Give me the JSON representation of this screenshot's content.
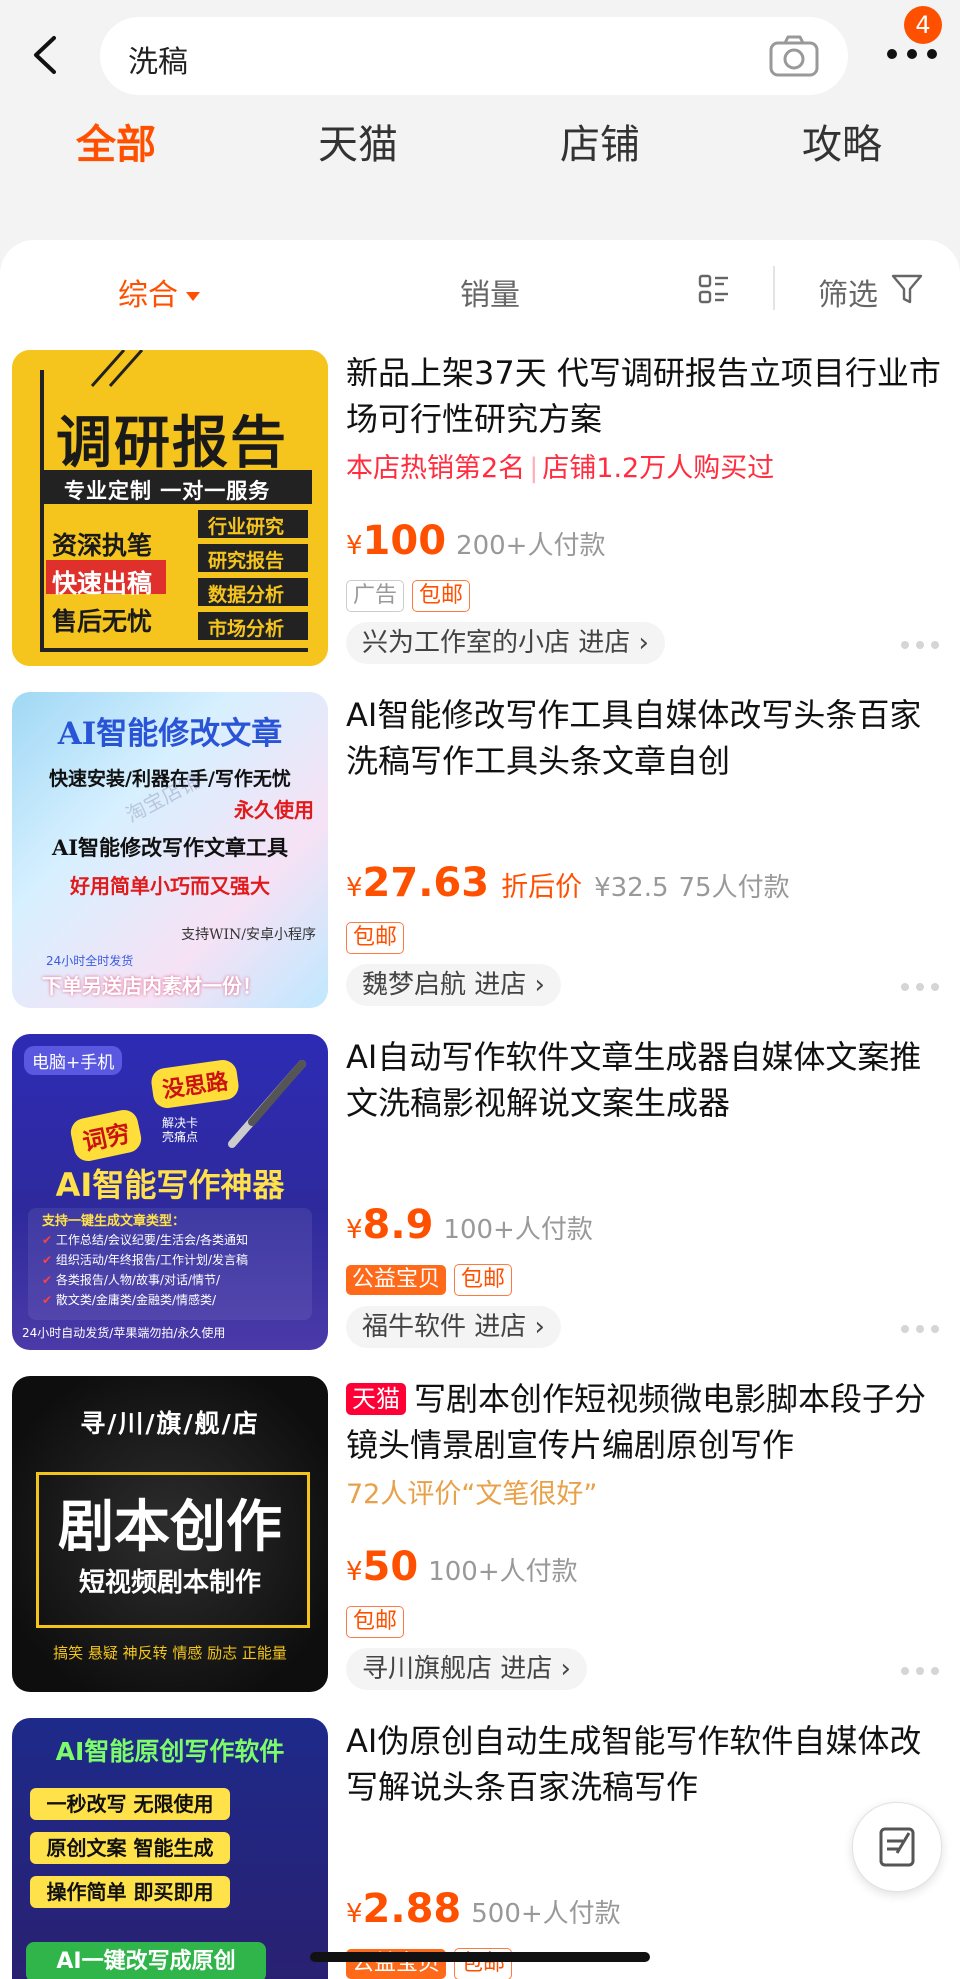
{
  "search": {
    "query": "洗稿",
    "badge_count": "4"
  },
  "tabs": [
    {
      "label": "全部",
      "active": true
    },
    {
      "label": "天猫",
      "active": false
    },
    {
      "label": "店铺",
      "active": false
    },
    {
      "label": "攻略",
      "active": false
    }
  ],
  "sort": {
    "comprehensive": "综合",
    "sales": "销量",
    "filter": "筛选"
  },
  "products": [
    {
      "title": "新品上架37天 代写调研报告立项目行业市场可行性研究方案",
      "rank_a": "本店热销第2名",
      "rank_b": "店铺1.2万人购买过",
      "price_symbol": "¥",
      "price": "100",
      "sold": "200+人付款",
      "tags": [
        "广告",
        "包邮"
      ],
      "shop": "兴为工作室的小店 进店",
      "thumb": {
        "headline": "调研报告",
        "strip": "专业定制 一对一服务",
        "left": [
          "资深执笔",
          "快速出稿",
          "售后无忧"
        ],
        "right": [
          "行业研究",
          "研究报告",
          "数据分析",
          "市场分析"
        ]
      }
    },
    {
      "title": "AI智能修改写作工具自媒体改写头条百家洗稿写作工具头条文章自创",
      "price_symbol": "¥",
      "price": "27.63",
      "deal": "折后价",
      "orig": "¥32.5",
      "sold": "75人付款",
      "tags": [
        "包邮"
      ],
      "shop": "魏梦启航 进店",
      "thumb": {
        "headline": "AI智能修改文章",
        "l1": "快速安装/利器在手/写作无忧",
        "l2": "永久使用",
        "l3": "AI智能修改写作文章工具",
        "l4": "好用简单小巧而又强大",
        "l5": "支持WIN/安卓小程序",
        "l6": "24小时全时发货",
        "l7": "下单另送店内素材一份！",
        "watermark": "淘宝店铺"
      }
    },
    {
      "title": "AI自动写作软件文章生成器自媒体文案推文洗稿影视解说文案生成器",
      "price_symbol": "¥",
      "price": "8.9",
      "sold": "100+人付款",
      "tags": [
        "公益宝贝",
        "包邮"
      ],
      "shop": "福牛软件 进店",
      "thumb": {
        "corner": "电脑+手机",
        "bubble1": "没思路",
        "bubble2": "词穷",
        "bubble3": "解决卡壳痛点",
        "headline": "AI智能写作神器",
        "sub": "支持一键生成文章类型：",
        "items": [
          "工作总结/会议纪要/生活会/各类通知",
          "组织活动/年终报告/工作计划/发言稿",
          "各类报告/人物/故事/对话/情节/",
          "散文类/金庸类/金融类/情感类/"
        ],
        "footer": "24小时自动发货/苹果端勿拍/永久使用"
      }
    },
    {
      "title_badge": "天猫",
      "title": "写剧本创作短视频微电影脚本段子分镜头情景剧宣传片编剧原创写作",
      "review": "72人评价“文笔很好”",
      "price_symbol": "¥",
      "price": "50",
      "sold": "100+人付款",
      "tags": [
        "包邮"
      ],
      "shop": "寻川旗舰店 进店",
      "thumb": {
        "top": "寻/川/旗/舰/店",
        "headline": "剧本创作",
        "sub": "短视频剧本制作",
        "bottom": "搞笑 悬疑 神反转 情感 励志 正能量"
      }
    },
    {
      "title": "AI伪原创自动生成智能写作软件自媒体改写解说头条百家洗稿写作",
      "price_symbol": "¥",
      "price": "2.88",
      "sold": "500+人付款",
      "tags": [
        "公益宝贝",
        "包邮"
      ],
      "thumb": {
        "headline": "AI智能原创写作软件",
        "items": [
          "一秒改写 无限使用",
          "原创文案 智能生成",
          "操作简单 即买即用"
        ],
        "footer": "AI一键改写成原创"
      }
    }
  ],
  "colors": {
    "accent": "#ff5000",
    "tmall": "#ff0036",
    "rank": "#ff2d3f"
  }
}
